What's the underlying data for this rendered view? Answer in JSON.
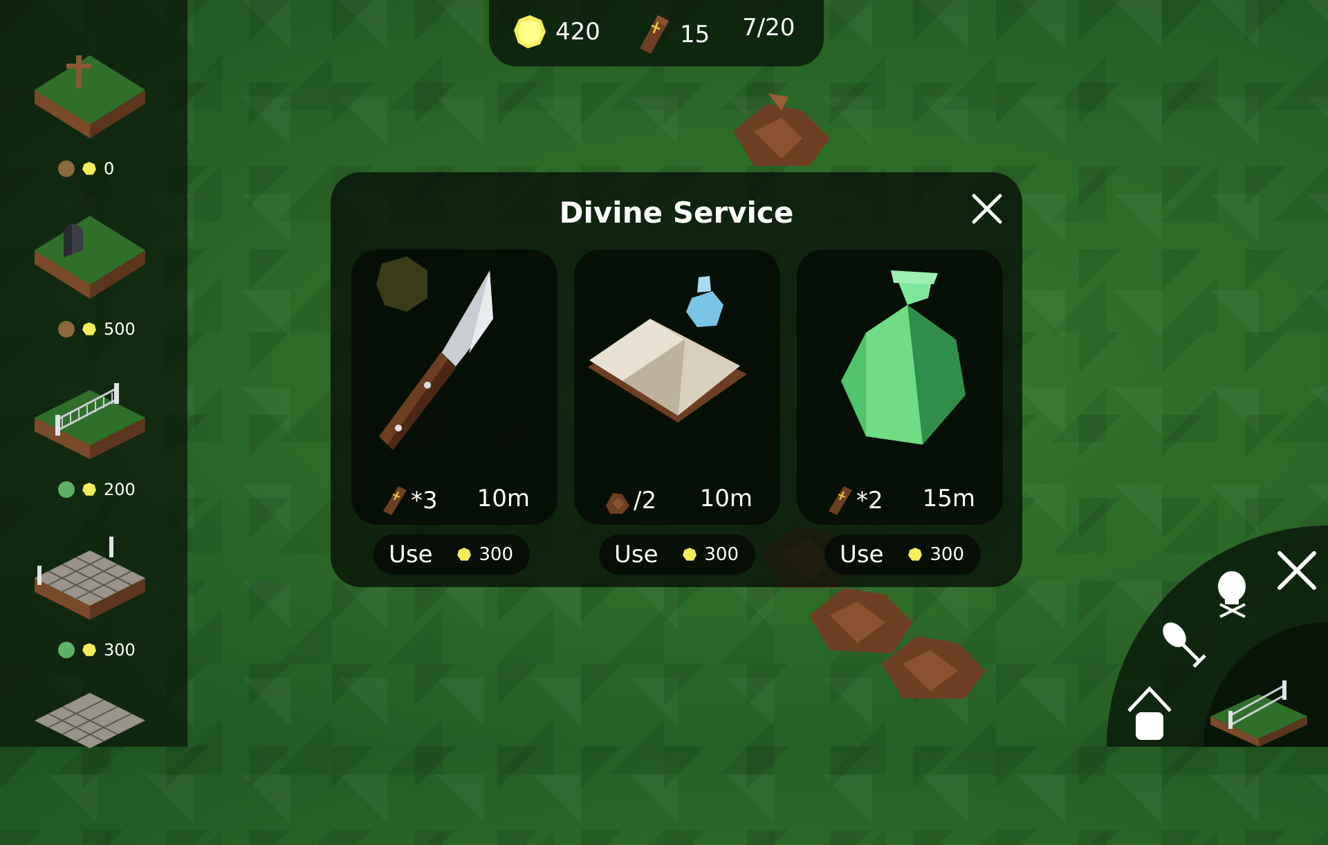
{
  "colors": {
    "grass": "#2c6a28",
    "panel": "#0e1a0e",
    "coin": "#f4ee5a",
    "brown_dot": "#8a6a3c",
    "green_dot": "#5fb068"
  },
  "topbar": {
    "coins": "420",
    "coffins": "15",
    "capacity": "7/20"
  },
  "sidebar": {
    "items": [
      {
        "tile": "cross-grave-tile",
        "dot": "brown",
        "price": "0"
      },
      {
        "tile": "tombstone-tile",
        "dot": "brown",
        "price": "500"
      },
      {
        "tile": "fence-tile",
        "dot": "green",
        "price": "200"
      },
      {
        "tile": "stone-path-fenced-tile",
        "dot": "green",
        "price": "300"
      },
      {
        "tile": "stone-path-tile",
        "dot": "green",
        "price": ""
      }
    ]
  },
  "dialog": {
    "title": "Divine Service",
    "cards": [
      {
        "icon": "knife-icon",
        "cost": "*3",
        "time": "10m",
        "use_label": "Use",
        "price": "300"
      },
      {
        "icon": "book-and-potion-icon",
        "cost": "/2",
        "time": "10m",
        "use_label": "Use",
        "price": "300"
      },
      {
        "icon": "green-potion-icon",
        "cost": "*2",
        "time": "15m",
        "use_label": "Use",
        "price": "300"
      }
    ]
  },
  "radial_menu": {
    "items": [
      "close-icon",
      "skull-icon",
      "shovel-icon",
      "home-icon",
      "fence-tile-icon"
    ]
  }
}
